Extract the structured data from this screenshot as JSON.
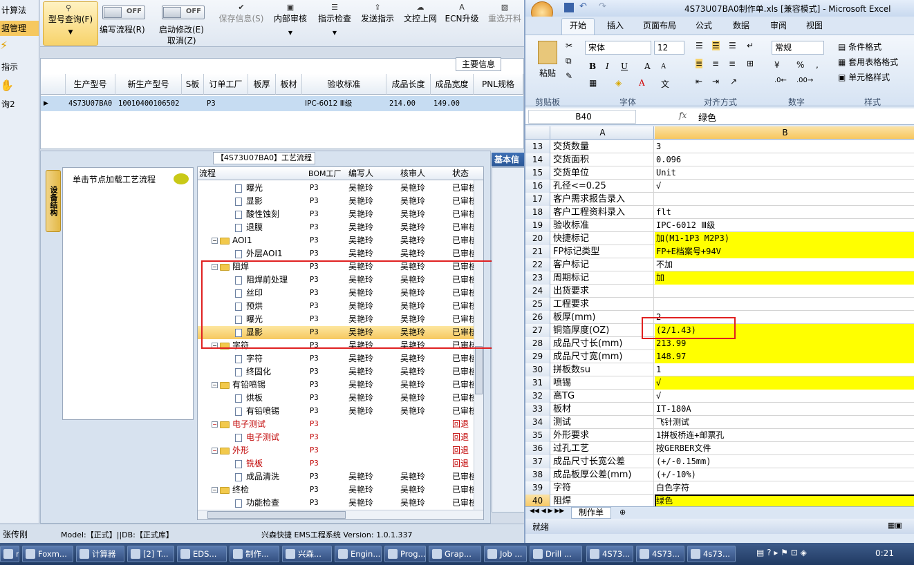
{
  "left_strip": {
    "items": [
      "计算法",
      "据管理",
      "指示",
      "询2"
    ]
  },
  "toolbar": {
    "query": {
      "label": "型号查询(F)",
      "icon": "search-icon"
    },
    "edit_flow": {
      "toggle": "OFF",
      "label": "编写流程(R)"
    },
    "start_modify": {
      "toggle": "OFF",
      "label": "启动修改(E)",
      "label2": "取消(Z)"
    },
    "buttons": [
      {
        "label": "保存信息(S)",
        "icon": "check-icon",
        "disabled": true
      },
      {
        "label": "内部审核",
        "icon": "print-icon"
      },
      {
        "label": "指示检查",
        "icon": "list-icon"
      },
      {
        "label": "发送指示",
        "icon": "upload-icon"
      },
      {
        "label": "文控上网",
        "icon": "cloud-icon"
      },
      {
        "label": "ECN升级",
        "icon": "a-icon"
      },
      {
        "label": "重选开料",
        "icon": "image-icon",
        "disabled": true
      }
    ]
  },
  "main_info": {
    "title": "主要信息",
    "headers": [
      "生产型号",
      "新生产型号",
      "S板",
      "订单工厂",
      "板厚",
      "板材",
      "验收标准",
      "成品长度",
      "成品宽度",
      "PNL规格"
    ],
    "row": [
      "4S73U07BA0",
      "10010400106502",
      "",
      "P3",
      "",
      "",
      "IPC-6012 Ⅲ级",
      "214.00",
      "149.00",
      ""
    ]
  },
  "process": {
    "title": "【4S73U07BA0】工艺流程",
    "side_tab": "设备结构",
    "hint": "单击节点加载工艺流程",
    "right_tab": "基本信",
    "columns": [
      "流程",
      "BOM工厂",
      "编写人",
      "核审人",
      "状态"
    ],
    "rows": [
      {
        "name": "曝光",
        "level": 2,
        "type": "doc",
        "bom": "P3",
        "writer": "吴艳玲",
        "reviewer": "吴艳玲",
        "status": "已审核"
      },
      {
        "name": "显影",
        "level": 2,
        "type": "doc",
        "bom": "P3",
        "writer": "吴艳玲",
        "reviewer": "吴艳玲",
        "status": "已审核"
      },
      {
        "name": "酸性蚀刻",
        "level": 2,
        "type": "doc",
        "bom": "P3",
        "writer": "吴艳玲",
        "reviewer": "吴艳玲",
        "status": "已审核"
      },
      {
        "name": "退膜",
        "level": 2,
        "type": "doc",
        "bom": "P3",
        "writer": "吴艳玲",
        "reviewer": "吴艳玲",
        "status": "已审核"
      },
      {
        "name": "AOI1",
        "level": 1,
        "type": "folder",
        "bom": "P3",
        "writer": "吴艳玲",
        "reviewer": "吴艳玲",
        "status": "已审核"
      },
      {
        "name": "外层AOI1",
        "level": 2,
        "type": "doc",
        "bom": "P3",
        "writer": "吴艳玲",
        "reviewer": "吴艳玲",
        "status": "已审核"
      },
      {
        "name": "阻焊",
        "level": 1,
        "type": "folder",
        "bom": "P3",
        "writer": "吴艳玲",
        "reviewer": "吴艳玲",
        "status": "已审核"
      },
      {
        "name": "阻焊前处理",
        "level": 2,
        "type": "doc",
        "bom": "P3",
        "writer": "吴艳玲",
        "reviewer": "吴艳玲",
        "status": "已审核"
      },
      {
        "name": "丝印",
        "level": 2,
        "type": "doc",
        "bom": "P3",
        "writer": "吴艳玲",
        "reviewer": "吴艳玲",
        "status": "已审核"
      },
      {
        "name": "预烘",
        "level": 2,
        "type": "doc",
        "bom": "P3",
        "writer": "吴艳玲",
        "reviewer": "吴艳玲",
        "status": "已审核"
      },
      {
        "name": "曝光",
        "level": 2,
        "type": "doc",
        "bom": "P3",
        "writer": "吴艳玲",
        "reviewer": "吴艳玲",
        "status": "已审核"
      },
      {
        "name": "显影",
        "level": 2,
        "type": "doc",
        "bom": "P3",
        "writer": "吴艳玲",
        "reviewer": "吴艳玲",
        "status": "已审核",
        "selected": true
      },
      {
        "name": "字符",
        "level": 1,
        "type": "folder",
        "bom": "P3",
        "writer": "吴艳玲",
        "reviewer": "吴艳玲",
        "status": "已审核"
      },
      {
        "name": "字符",
        "level": 2,
        "type": "doc",
        "bom": "P3",
        "writer": "吴艳玲",
        "reviewer": "吴艳玲",
        "status": "已审核"
      },
      {
        "name": "终固化",
        "level": 2,
        "type": "doc",
        "bom": "P3",
        "writer": "吴艳玲",
        "reviewer": "吴艳玲",
        "status": "已审核"
      },
      {
        "name": "有铅喷锡",
        "level": 1,
        "type": "folder",
        "bom": "P3",
        "writer": "吴艳玲",
        "reviewer": "吴艳玲",
        "status": "已审核"
      },
      {
        "name": "烘板",
        "level": 2,
        "type": "doc",
        "bom": "P3",
        "writer": "吴艳玲",
        "reviewer": "吴艳玲",
        "status": "已审核"
      },
      {
        "name": "有铅喷锡",
        "level": 2,
        "type": "doc",
        "bom": "P3",
        "writer": "吴艳玲",
        "reviewer": "吴艳玲",
        "status": "已审核"
      },
      {
        "name": "电子测试",
        "level": 1,
        "type": "folder",
        "bom": "P3",
        "writer": "",
        "reviewer": "",
        "status": "回退",
        "red": true
      },
      {
        "name": "电子测试",
        "level": 2,
        "type": "doc",
        "bom": "P3",
        "writer": "",
        "reviewer": "",
        "status": "回退",
        "red": true
      },
      {
        "name": "外形",
        "level": 1,
        "type": "folder",
        "bom": "P3",
        "writer": "",
        "reviewer": "",
        "status": "回退",
        "red": true
      },
      {
        "name": "铣板",
        "level": 2,
        "type": "doc",
        "bom": "P3",
        "writer": "",
        "reviewer": "",
        "status": "回退",
        "red": true
      },
      {
        "name": "成品清洗",
        "level": 2,
        "type": "doc",
        "bom": "P3",
        "writer": "吴艳玲",
        "reviewer": "吴艳玲",
        "status": "已审核"
      },
      {
        "name": "终检",
        "level": 1,
        "type": "folder",
        "bom": "P3",
        "writer": "吴艳玲",
        "reviewer": "吴艳玲",
        "status": "已审核"
      },
      {
        "name": "功能检查",
        "level": 2,
        "type": "doc",
        "bom": "P3",
        "writer": "吴艳玲",
        "reviewer": "吴艳玲",
        "status": "已审核"
      }
    ]
  },
  "status_bar": {
    "user": "张传刚",
    "model": "Model:【正式】||DB:【正式库】",
    "system": "兴森快捷 EMS工程系统 Version: 1.0.1.337"
  },
  "excel": {
    "title": "4S73U07BA0制作单.xls [兼容模式] - Microsoft Excel",
    "tabs": [
      "开始",
      "插入",
      "页面布局",
      "公式",
      "数据",
      "审阅",
      "视图"
    ],
    "ribbon": {
      "paste": "粘贴",
      "font_name": "宋体",
      "font_size": "12",
      "number_format": "常规",
      "styles": [
        "条件格式",
        "套用表格格式",
        "单元格样式"
      ],
      "groups": [
        "剪贴板",
        "字体",
        "对齐方式",
        "数字",
        "样式"
      ]
    },
    "name_box": "B40",
    "fx": "fx",
    "formula_value": "绿色",
    "col_a": "A",
    "col_b": "B",
    "rows": [
      {
        "n": "13",
        "a": "交货数量",
        "b": "3",
        "y": false
      },
      {
        "n": "14",
        "a": "交货面积",
        "b": "0.096",
        "y": false
      },
      {
        "n": "15",
        "a": "交货单位",
        "b": "Unit",
        "y": false
      },
      {
        "n": "16",
        "a": "孔径<=0.25",
        "b": "√",
        "y": false
      },
      {
        "n": "17",
        "a": "客户需求报告录入",
        "b": "",
        "y": false
      },
      {
        "n": "18",
        "a": "客户工程资料录入",
        "b": "flt",
        "y": false
      },
      {
        "n": "19",
        "a": "验收标准",
        "b": "IPC-6012 Ⅲ级",
        "y": false
      },
      {
        "n": "20",
        "a": "快捷标记",
        "b": "加(M1-1P3 M2P3)",
        "y": true
      },
      {
        "n": "21",
        "a": "FP标记类型",
        "b": "FP+E档案号+94V",
        "y": true
      },
      {
        "n": "22",
        "a": "客户标记",
        "b": "不加",
        "y": false
      },
      {
        "n": "23",
        "a": "周期标记",
        "b": "加",
        "y": true
      },
      {
        "n": "24",
        "a": "出货要求",
        "b": "",
        "y": false
      },
      {
        "n": "25",
        "a": "工程要求",
        "b": "",
        "y": false
      },
      {
        "n": "26",
        "a": "板厚(mm)",
        "b": "2",
        "y": false
      },
      {
        "n": "27",
        "a": "铜箔厚度(OZ)",
        "b": "(2/1.43)",
        "y": true
      },
      {
        "n": "28",
        "a": "成品尺寸长(mm)",
        "b": "213.99",
        "y": true
      },
      {
        "n": "29",
        "a": "成品尺寸宽(mm)",
        "b": "148.97",
        "y": true
      },
      {
        "n": "30",
        "a": "拼板数su",
        "b": "1",
        "y": false
      },
      {
        "n": "31",
        "a": "喷锡",
        "b": "√",
        "y": true
      },
      {
        "n": "32",
        "a": "高TG",
        "b": "√",
        "y": false
      },
      {
        "n": "33",
        "a": "板材",
        "b": "IT-180A",
        "y": false
      },
      {
        "n": "34",
        "a": "测试",
        "b": "飞针测试",
        "y": false
      },
      {
        "n": "35",
        "a": "外形要求",
        "b": "1拼板桥连+邮票孔",
        "y": false
      },
      {
        "n": "36",
        "a": "过孔工艺",
        "b": "按GERBER文件",
        "y": false
      },
      {
        "n": "37",
        "a": "成品尺寸长宽公差",
        "b": "(+/-0.15mm)",
        "y": false
      },
      {
        "n": "38",
        "a": "成品板厚公差(mm)",
        "b": "(+/-10%)",
        "y": false
      },
      {
        "n": "39",
        "a": "字符",
        "b": "白色字符",
        "y": false
      },
      {
        "n": "40",
        "a": "阻焊",
        "b": "绿色",
        "y": true
      }
    ],
    "sheet_tab": "制作单",
    "status": "就绪"
  },
  "taskbar": {
    "items": [
      "ne...",
      "Foxm...",
      "计算器",
      "[2] T...",
      "EDS...",
      "制作...",
      "兴森...",
      "Engin...",
      "Prog...",
      "Grap...",
      "Job ...",
      "Drill ...",
      "4S73...",
      "4S73...",
      "4s73..."
    ],
    "clock": "0:21"
  }
}
